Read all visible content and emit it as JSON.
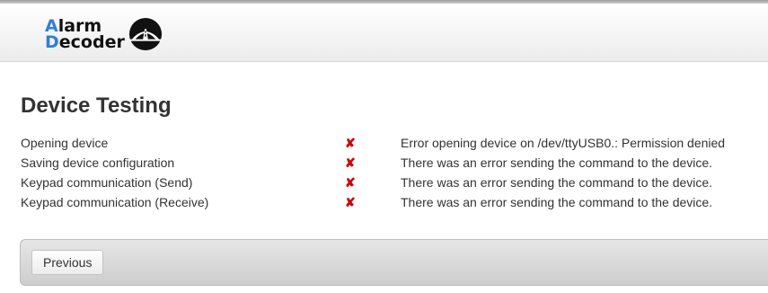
{
  "header": {
    "logo": {
      "line1_initial": "A",
      "line1_rest": "larm",
      "line2_initial": "D",
      "line2_rest": "ecoder",
      "icon": "road-tunnel-icon"
    }
  },
  "page": {
    "title": "Device Testing"
  },
  "tests": [
    {
      "name": "Opening device",
      "status_icon": "red-x-icon",
      "status": "✘",
      "message": "Error opening device on /dev/ttyUSB0.: Permission denied"
    },
    {
      "name": "Saving device configuration",
      "status_icon": "red-x-icon",
      "status": "✘",
      "message": "There was an error sending the command to the device."
    },
    {
      "name": "Keypad communication (Send)",
      "status_icon": "red-x-icon",
      "status": "✘",
      "message": "There was an error sending the command to the device."
    },
    {
      "name": "Keypad communication (Receive)",
      "status_icon": "red-x-icon",
      "status": "✘",
      "message": "There was an error sending the command to the device."
    }
  ],
  "footer": {
    "previous_label": "Previous"
  },
  "colors": {
    "accent": "#2f7fd6",
    "error": "#d00000"
  }
}
